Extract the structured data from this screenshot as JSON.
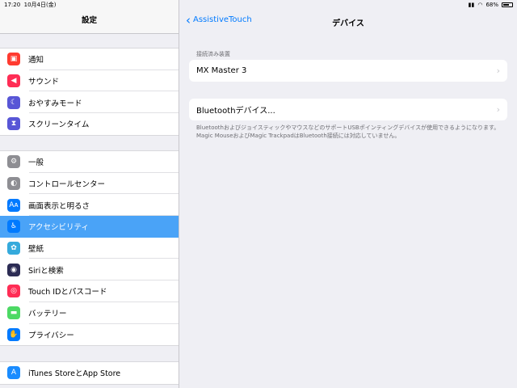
{
  "status": {
    "time": "17:20",
    "date": "10月4日(金)",
    "battery": "68%",
    "battery_level": 0.68
  },
  "sidebar": {
    "title": "設定",
    "groups": [
      [
        {
          "label": "通知",
          "icon": "notifications-icon",
          "color": "#ff3b30"
        },
        {
          "label": "サウンド",
          "icon": "sound-icon",
          "color": "#ff2d55"
        },
        {
          "label": "おやすみモード",
          "icon": "moon-icon",
          "color": "#5856d6"
        },
        {
          "label": "スクリーンタイム",
          "icon": "hourglass-icon",
          "color": "#5856d6"
        }
      ],
      [
        {
          "label": "一般",
          "icon": "gear-icon",
          "color": "#8e8e93"
        },
        {
          "label": "コントロールセンター",
          "icon": "toggles-icon",
          "color": "#8e8e93"
        },
        {
          "label": "画面表示と明るさ",
          "icon": "display-icon",
          "color": "#007aff"
        },
        {
          "label": "アクセシビリティ",
          "icon": "accessibility-icon",
          "color": "#007aff",
          "selected": true
        },
        {
          "label": "壁紙",
          "icon": "wallpaper-icon",
          "color": "#35aadc"
        },
        {
          "label": "Siriと検索",
          "icon": "siri-icon",
          "color": "#2c2c54"
        },
        {
          "label": "Touch IDとパスコード",
          "icon": "fingerprint-icon",
          "color": "#ff2d55"
        },
        {
          "label": "バッテリー",
          "icon": "battery-icon",
          "color": "#4cd964"
        },
        {
          "label": "プライバシー",
          "icon": "hand-icon",
          "color": "#007aff"
        }
      ],
      [
        {
          "label": "iTunes StoreとApp Store",
          "icon": "app-store-icon",
          "color": "#1a8cff"
        }
      ]
    ]
  },
  "main": {
    "back_label": "AssistiveTouch",
    "title": "デバイス",
    "section_label": "接続済み装置",
    "connected_device": "MX Master 3",
    "bluetooth_label": "Bluetoothデバイス...",
    "footer": "BluetoothおよびジョイスティックやマウスなどのサポートUSBポインティングデバイスが使用できるようになります。Magic MouseおよびMagic TrackpadはBluetooth接続には対応していません。"
  }
}
